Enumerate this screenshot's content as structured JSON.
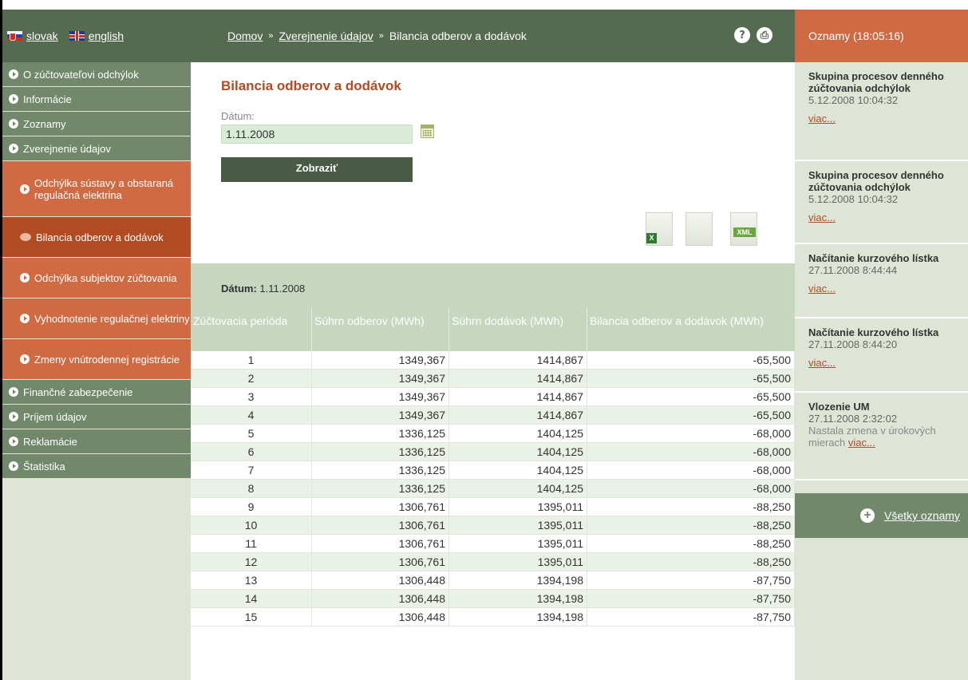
{
  "lang": {
    "slovak": "slovak",
    "english": "english"
  },
  "sidebar": {
    "items": [
      {
        "label": "O zúčtovateľovi odchýlok"
      },
      {
        "label": "Informácie"
      },
      {
        "label": "Zoznamy"
      },
      {
        "label": "Zverejnenie údajov"
      }
    ],
    "subitems": [
      {
        "label": "Odchýlka sústavy a obstaraná regulačná elektrina"
      },
      {
        "label": "Bilancia odberov a dodávok"
      },
      {
        "label": "Odchýlka subjektov zúčtovania"
      },
      {
        "label": "Vyhodnotenie regulačnej elektriny"
      },
      {
        "label": "Zmeny vnútrodennej registrácie"
      }
    ],
    "items_after": [
      {
        "label": "Finančné zabezpečenie"
      },
      {
        "label": "Príjem údajov"
      },
      {
        "label": "Reklamácie"
      },
      {
        "label": "Štatistika"
      }
    ]
  },
  "breadcrumb": {
    "home": "Domov",
    "section": "Zverejnenie údajov",
    "current": "Bilancia odberov a dodávok",
    "sep": "»"
  },
  "header_icons": {
    "help": "?",
    "print": "⎙"
  },
  "main": {
    "title": "Bilancia odberov a dodávok",
    "date_label": "Dátum:",
    "date_value": "1.11.2008",
    "show_button": "Zobraziť",
    "excel_tag": "X",
    "xml_tag": "XML",
    "result_label": "Dátum:",
    "result_value": "1.11.2008"
  },
  "table": {
    "headers": [
      "Zúčtovacia perióda",
      "Súhrn odberov (MWh)",
      "Súhrn dodávok (MWh)",
      "Bilancia odberov a dodávok (MWh)"
    ],
    "rows": [
      [
        "1",
        "1349,367",
        "1414,867",
        "-65,500"
      ],
      [
        "2",
        "1349,367",
        "1414,867",
        "-65,500"
      ],
      [
        "3",
        "1349,367",
        "1414,867",
        "-65,500"
      ],
      [
        "4",
        "1349,367",
        "1414,867",
        "-65,500"
      ],
      [
        "5",
        "1336,125",
        "1404,125",
        "-68,000"
      ],
      [
        "6",
        "1336,125",
        "1404,125",
        "-68,000"
      ],
      [
        "7",
        "1336,125",
        "1404,125",
        "-68,000"
      ],
      [
        "8",
        "1336,125",
        "1404,125",
        "-68,000"
      ],
      [
        "9",
        "1306,761",
        "1395,011",
        "-88,250"
      ],
      [
        "10",
        "1306,761",
        "1395,011",
        "-88,250"
      ],
      [
        "11",
        "1306,761",
        "1395,011",
        "-88,250"
      ],
      [
        "12",
        "1306,761",
        "1395,011",
        "-88,250"
      ],
      [
        "13",
        "1306,448",
        "1394,198",
        "-87,750"
      ],
      [
        "14",
        "1306,448",
        "1394,198",
        "-87,750"
      ],
      [
        "15",
        "1306,448",
        "1394,198",
        "-87,750"
      ]
    ]
  },
  "right": {
    "header": "Oznamy (18:05:16)",
    "news": [
      {
        "title": "Skupina procesov denného zúčtovania odchýlok",
        "date": "5.12.2008 10:04:32",
        "text": "",
        "more": "viac..."
      },
      {
        "title": "Skupina procesov denného zúčtovania odchýlok",
        "date": "5.12.2008 10:04:32",
        "text": "",
        "more": "viac..."
      },
      {
        "title": "Načítanie kurzového lístka",
        "date": "27.11.2008 8:44:44",
        "text": "",
        "more": "viac..."
      },
      {
        "title": "Načítanie kurzového lístka",
        "date": "27.11.2008 8:44:20",
        "text": "",
        "more": "viac..."
      },
      {
        "title": "Vlozenie UM",
        "date": "27.11.2008 2:32:02",
        "text": "Nastala zmena v úrokových mierach",
        "more": "viac..."
      }
    ],
    "all_label": "Všetky oznamy"
  }
}
